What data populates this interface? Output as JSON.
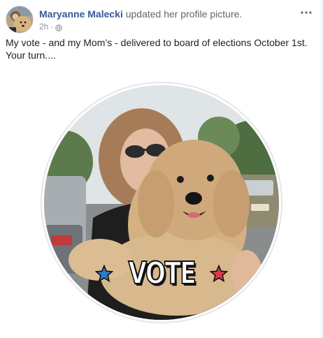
{
  "post": {
    "author_name": "Maryanne Malecki",
    "action": "updated her profile picture.",
    "timestamp": "2h",
    "separator": "·",
    "privacy_icon": "globe-icon",
    "more_icon": "more-options-icon",
    "body_lines": [
      "My vote - and my Mom’s - delivered to board of elections October 1st.",
      "Your turn...."
    ]
  },
  "photo": {
    "overlay_text": "VOTE",
    "left_star_color": "#2a7bd1",
    "right_star_color": "#d93a4a"
  },
  "colors": {
    "link": "#385898",
    "meta": "#90949c",
    "text": "#1c1e21"
  }
}
